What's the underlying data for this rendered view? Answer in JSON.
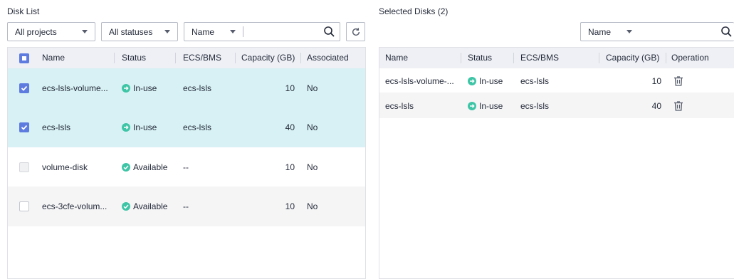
{
  "left": {
    "title": "Disk List",
    "project_filter": "All projects",
    "status_filter": "All statuses",
    "search_field": "Name",
    "search_value": "",
    "columns": [
      "Name",
      "Status",
      "ECS/BMS",
      "Capacity (GB)",
      "Associated"
    ],
    "rows": [
      {
        "name": "ecs-lsls-volume...",
        "status": "In-use",
        "ecs": "ecs-lsls",
        "capacity": "10",
        "associated": "No",
        "checked": true,
        "disabled": false
      },
      {
        "name": "ecs-lsls",
        "status": "In-use",
        "ecs": "ecs-lsls",
        "capacity": "40",
        "associated": "No",
        "checked": true,
        "disabled": false
      },
      {
        "name": "volume-disk",
        "status": "Available",
        "ecs": "--",
        "capacity": "10",
        "associated": "No",
        "checked": false,
        "disabled": true
      },
      {
        "name": "ecs-3cfe-volum...",
        "status": "Available",
        "ecs": "--",
        "capacity": "10",
        "associated": "No",
        "checked": false,
        "disabled": false
      }
    ]
  },
  "right": {
    "title": "Selected Disks (2)",
    "search_field": "Name",
    "columns": [
      "Name",
      "Status",
      "ECS/BMS",
      "Capacity (GB)",
      "Operation"
    ],
    "rows": [
      {
        "name": "ecs-lsls-volume-...",
        "status": "In-use",
        "ecs": "ecs-lsls",
        "capacity": "10"
      },
      {
        "name": "ecs-lsls",
        "status": "In-use",
        "ecs": "ecs-lsls",
        "capacity": "40"
      }
    ]
  },
  "icons": {
    "search": "search-icon",
    "refresh": "refresh-icon",
    "delete": "trash-icon",
    "in_use": "arrow-right-circle-icon",
    "available": "check-circle-icon"
  },
  "colors": {
    "accent": "#5e7ce0",
    "status_green": "#3ec5a6",
    "selected_row": "#d7f1f4",
    "header_bg": "#eef0f5"
  }
}
